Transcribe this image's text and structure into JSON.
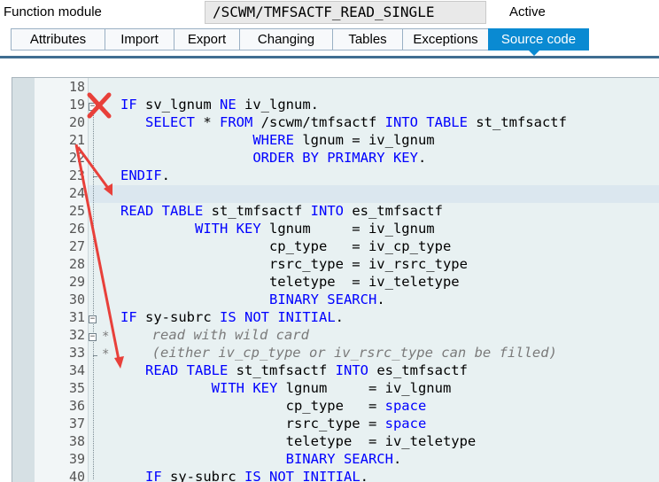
{
  "header": {
    "label": "Function module",
    "module_name": "/SCWM/TMFSACTF_READ_SINGLE",
    "status": "Active"
  },
  "tabs": [
    {
      "label": "Attributes",
      "active": false
    },
    {
      "label": "Import",
      "active": false
    },
    {
      "label": "Export",
      "active": false
    },
    {
      "label": "Changing",
      "active": false
    },
    {
      "label": "Tables",
      "active": false
    },
    {
      "label": "Exceptions",
      "active": false
    },
    {
      "label": "Source code",
      "active": true
    }
  ],
  "colors": {
    "active_tab": "#0a8ad2",
    "keyword": "#0000ff",
    "comment": "#7a7a7a",
    "annotation": "#e8403a"
  },
  "annotations": {
    "cross_icon": "red-x-mark",
    "arrows": "red-arrows"
  },
  "editor": {
    "lines": [
      {
        "no": "18",
        "segments": [
          {
            "t": "",
            "c": "n"
          }
        ]
      },
      {
        "no": "19",
        "segments": [
          {
            "t": "IF",
            "c": "kw"
          },
          {
            "t": " sv_lgnum ",
            "c": "n"
          },
          {
            "t": "NE",
            "c": "kw"
          },
          {
            "t": " iv_lgnum.",
            "c": "n"
          }
        ]
      },
      {
        "no": "20",
        "segments": [
          {
            "t": "   ",
            "c": "n"
          },
          {
            "t": "SELECT",
            "c": "kw"
          },
          {
            "t": " * ",
            "c": "n"
          },
          {
            "t": "FROM",
            "c": "kw"
          },
          {
            "t": " /scwm/tmfsactf ",
            "c": "n"
          },
          {
            "t": "INTO TABLE",
            "c": "kw"
          },
          {
            "t": " st_tmfsactf",
            "c": "n"
          }
        ]
      },
      {
        "no": "21",
        "segments": [
          {
            "t": "                ",
            "c": "n"
          },
          {
            "t": "WHERE",
            "c": "kw"
          },
          {
            "t": " lgnum = iv_lgnum",
            "c": "n"
          }
        ]
      },
      {
        "no": "22",
        "segments": [
          {
            "t": "                ",
            "c": "n"
          },
          {
            "t": "ORDER BY PRIMARY KEY",
            "c": "kw"
          },
          {
            "t": ".",
            "c": "n"
          }
        ]
      },
      {
        "no": "23",
        "segments": [
          {
            "t": "ENDIF",
            "c": "kw"
          },
          {
            "t": ".",
            "c": "n"
          }
        ]
      },
      {
        "no": "24",
        "segments": [
          {
            "t": "",
            "c": "n"
          }
        ]
      },
      {
        "no": "25",
        "segments": [
          {
            "t": "READ TABLE",
            "c": "kw"
          },
          {
            "t": " st_tmfsactf ",
            "c": "n"
          },
          {
            "t": "INTO",
            "c": "kw"
          },
          {
            "t": " es_tmfsactf",
            "c": "n"
          }
        ]
      },
      {
        "no": "26",
        "segments": [
          {
            "t": "         ",
            "c": "n"
          },
          {
            "t": "WITH KEY",
            "c": "kw"
          },
          {
            "t": " lgnum     = iv_lgnum",
            "c": "n"
          }
        ]
      },
      {
        "no": "27",
        "segments": [
          {
            "t": "                  cp_type   = iv_cp_type",
            "c": "n"
          }
        ]
      },
      {
        "no": "28",
        "segments": [
          {
            "t": "                  rsrc_type = iv_rsrc_type",
            "c": "n"
          }
        ]
      },
      {
        "no": "29",
        "segments": [
          {
            "t": "                  teletype  = iv_teletype",
            "c": "n"
          }
        ]
      },
      {
        "no": "30",
        "segments": [
          {
            "t": "                  ",
            "c": "n"
          },
          {
            "t": "BINARY SEARCH",
            "c": "kw"
          },
          {
            "t": ".",
            "c": "n"
          }
        ]
      },
      {
        "no": "31",
        "segments": [
          {
            "t": "IF",
            "c": "kw"
          },
          {
            "t": " sy-subrc ",
            "c": "n"
          },
          {
            "t": "IS NOT INITIAL",
            "c": "kw"
          },
          {
            "t": ".",
            "c": "n"
          }
        ]
      },
      {
        "no": "32",
        "segments": [
          {
            "t": "     read with wild card",
            "c": "cm"
          }
        ]
      },
      {
        "no": "33",
        "segments": [
          {
            "t": "     (either iv_cp_type or iv_rsrc_type can be filled)",
            "c": "cm"
          }
        ]
      },
      {
        "no": "34",
        "segments": [
          {
            "t": "   ",
            "c": "n"
          },
          {
            "t": "READ TABLE",
            "c": "kw"
          },
          {
            "t": " st_tmfsactf ",
            "c": "n"
          },
          {
            "t": "INTO",
            "c": "kw"
          },
          {
            "t": " es_tmfsactf",
            "c": "n"
          }
        ]
      },
      {
        "no": "35",
        "segments": [
          {
            "t": "           ",
            "c": "n"
          },
          {
            "t": "WITH KEY",
            "c": "kw"
          },
          {
            "t": " lgnum     = iv_lgnum",
            "c": "n"
          }
        ]
      },
      {
        "no": "36",
        "segments": [
          {
            "t": "                    cp_type   = ",
            "c": "n"
          },
          {
            "t": "space",
            "c": "kw"
          }
        ]
      },
      {
        "no": "37",
        "segments": [
          {
            "t": "                    rsrc_type = ",
            "c": "n"
          },
          {
            "t": "space",
            "c": "kw"
          }
        ]
      },
      {
        "no": "38",
        "segments": [
          {
            "t": "                    teletype  = iv_teletype",
            "c": "n"
          }
        ]
      },
      {
        "no": "39",
        "segments": [
          {
            "t": "                    ",
            "c": "n"
          },
          {
            "t": "BINARY SEARCH",
            "c": "kw"
          },
          {
            "t": ".",
            "c": "n"
          }
        ]
      },
      {
        "no": "40",
        "segments": [
          {
            "t": "   ",
            "c": "n"
          },
          {
            "t": "IF",
            "c": "kw"
          },
          {
            "t": " sy-subrc ",
            "c": "n"
          },
          {
            "t": "IS NOT INITIAL",
            "c": "kw"
          },
          {
            "t": ".",
            "c": "n"
          }
        ]
      }
    ],
    "comment_markers": [
      "*",
      "*"
    ]
  }
}
